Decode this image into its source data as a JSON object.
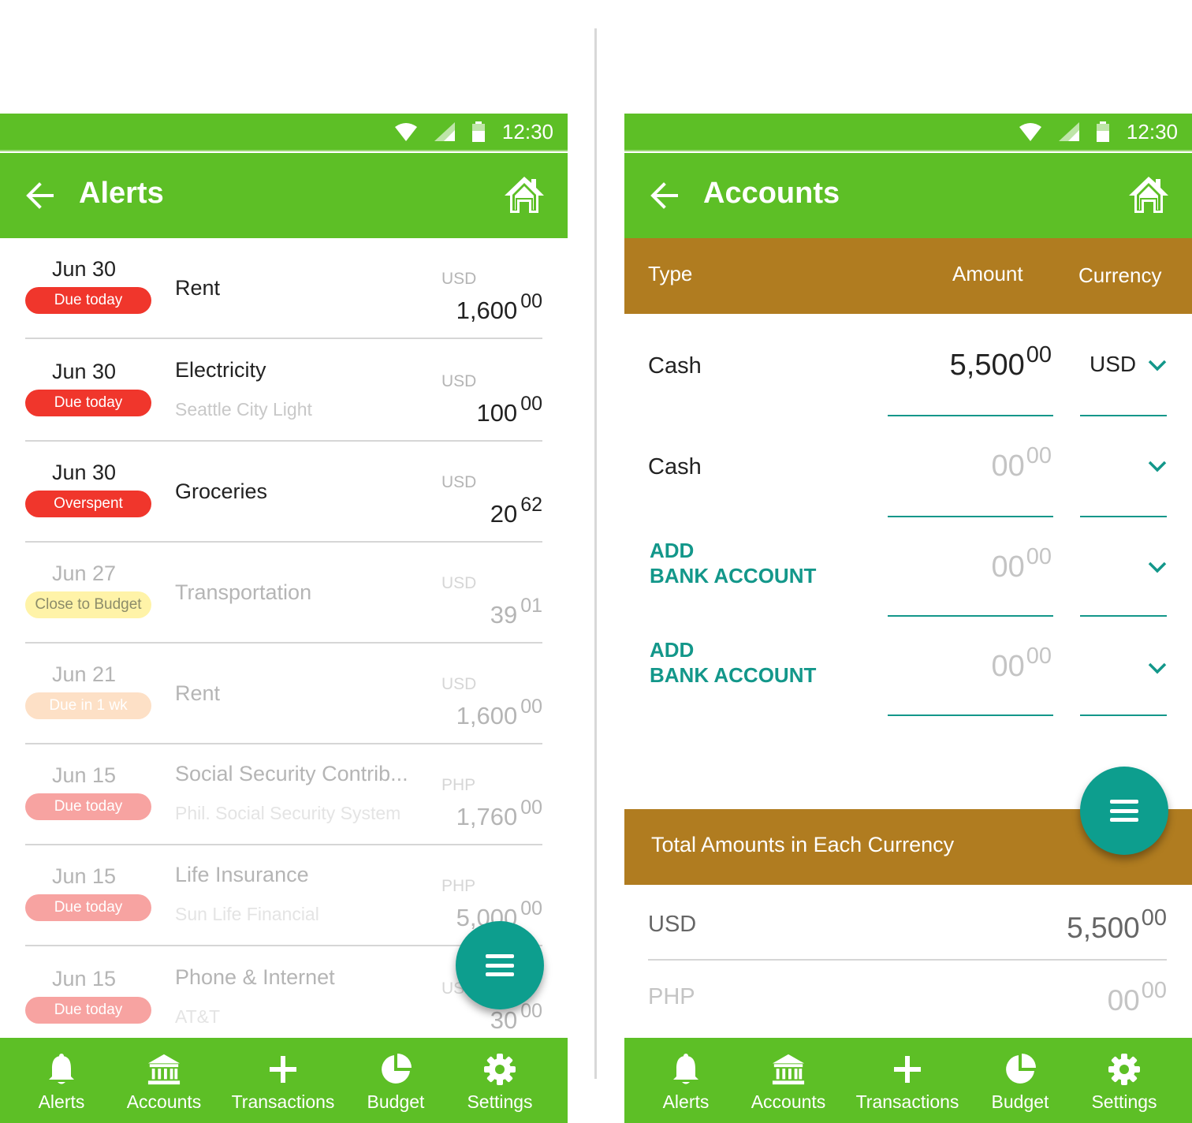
{
  "status_bar": {
    "time": "12:30"
  },
  "alerts_screen": {
    "title": "Alerts",
    "rows": [
      {
        "date": "Jun 30",
        "badge": "Due today",
        "name": "Rent",
        "sub": "",
        "currency": "USD",
        "amount": "1,600",
        "cents": "00"
      },
      {
        "date": "Jun 30",
        "badge": "Due today",
        "name": "Electricity",
        "sub": "Seattle City Light",
        "currency": "USD",
        "amount": "100",
        "cents": "00"
      },
      {
        "date": "Jun 30",
        "badge": "Overspent",
        "name": "Groceries",
        "sub": "",
        "currency": "USD",
        "amount": "20",
        "cents": "62"
      },
      {
        "date": "Jun 27",
        "badge": "Close to Budget",
        "name": "Transportation",
        "sub": "",
        "currency": "USD",
        "amount": "39",
        "cents": "01"
      },
      {
        "date": "Jun 21",
        "badge": "Due in 1 wk",
        "name": "Rent",
        "sub": "",
        "currency": "USD",
        "amount": "1,600",
        "cents": "00"
      },
      {
        "date": "Jun 15",
        "badge": "Due today",
        "name": "Social Security Contrib...",
        "sub": "Phil. Social Security System",
        "currency": "PHP",
        "amount": "1,760",
        "cents": "00"
      },
      {
        "date": "Jun 15",
        "badge": "Due today",
        "name": "Life Insurance",
        "sub": "Sun Life Financial",
        "currency": "PHP",
        "amount": "5,000",
        "cents": "00"
      },
      {
        "date": "Jun 15",
        "badge": "Due today",
        "name": "Phone & Internet",
        "sub": "AT&T",
        "currency": "USD",
        "amount": "30",
        "cents": "00"
      }
    ]
  },
  "accounts_screen": {
    "title": "Accounts",
    "columns": {
      "type": "Type",
      "amount": "Amount",
      "currency": "Currency"
    },
    "rows": [
      {
        "type": "Cash",
        "amount": "5,500",
        "cents": "00",
        "currency": "USD"
      },
      {
        "type": "Cash",
        "amount": "00",
        "cents": "00",
        "currency": ""
      },
      {
        "type": "ADD BANK ACCOUNT",
        "line1": "ADD",
        "line2": "BANK ACCOUNT",
        "amount": "00",
        "cents": "00",
        "currency": ""
      },
      {
        "type": "ADD BANK ACCOUNT",
        "line1": "ADD",
        "line2": "BANK ACCOUNT",
        "amount": "00",
        "cents": "00",
        "currency": ""
      }
    ],
    "totals_title": "Total Amounts in Each Currency",
    "totals": [
      {
        "currency": "USD",
        "amount": "5,500",
        "cents": "00"
      },
      {
        "currency": "PHP",
        "amount": "00",
        "cents": "00"
      }
    ]
  },
  "bottom_nav": {
    "items": [
      {
        "label": "Alerts",
        "icon": "bell-icon"
      },
      {
        "label": "Accounts",
        "icon": "bank-icon"
      },
      {
        "label": "Transactions",
        "icon": "plus-icon"
      },
      {
        "label": "Budget",
        "icon": "pie-chart-icon"
      },
      {
        "label": "Settings",
        "icon": "gear-icon"
      }
    ]
  },
  "colors": {
    "primary_green": "#5dbf26",
    "header_brown": "#b07c20",
    "teal": "#0d9e8e",
    "badge_red": "#f0362c"
  }
}
